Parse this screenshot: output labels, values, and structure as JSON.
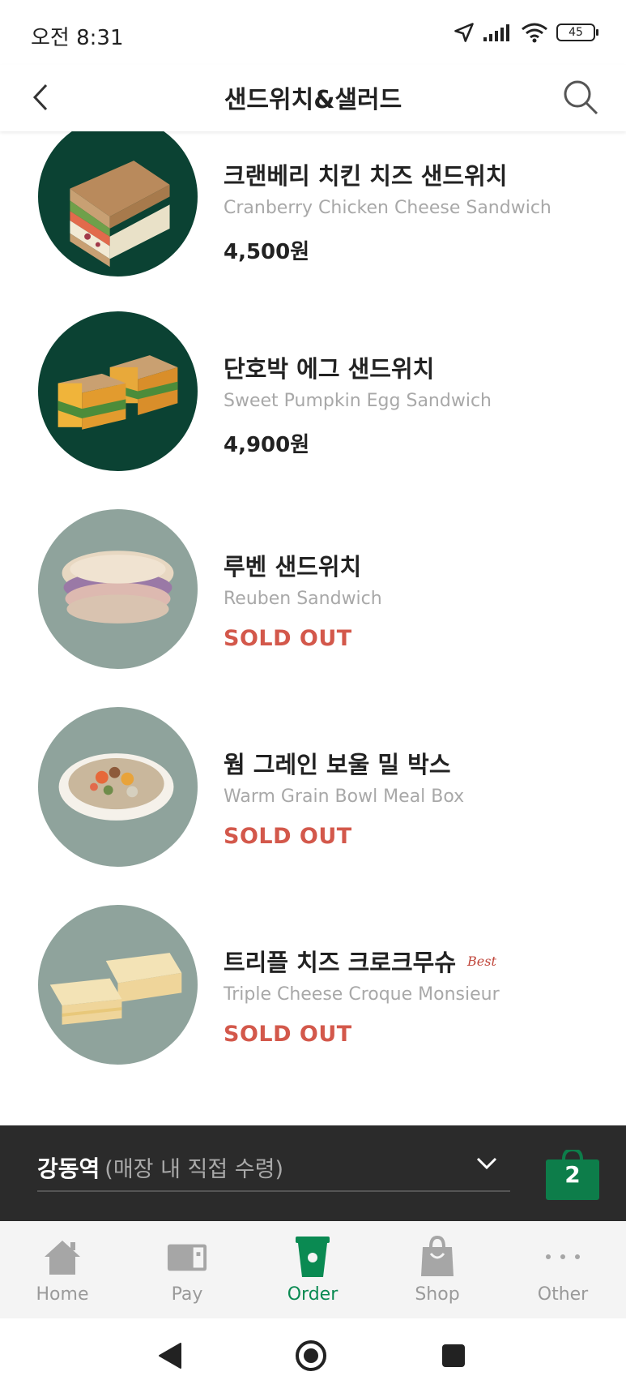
{
  "status_bar": {
    "time": "오전 8:31",
    "battery": "45"
  },
  "header": {
    "title": "샌드위치&샐러드"
  },
  "menu_items": [
    {
      "name_ko": "크랜베리 치킨 치즈 샌드위치",
      "name_en": "Cranberry Chicken Cheese Sandwich",
      "price": "4,500원"
    },
    {
      "name_ko": "단호박 에그 샌드위치",
      "name_en": "Sweet Pumpkin Egg Sandwich",
      "price": "4,900원"
    },
    {
      "name_ko": "루벤 샌드위치",
      "name_en": "Reuben Sandwich",
      "status": "SOLD OUT"
    },
    {
      "name_ko": "웜 그레인 보울 밀 박스",
      "name_en": "Warm Grain Bowl Meal Box",
      "status": "SOLD OUT"
    },
    {
      "name_ko": "트리플 치즈 크로크무슈",
      "badge": "Best",
      "name_en": "Triple Cheese Croque Monsieur",
      "status": "SOLD OUT"
    }
  ],
  "store_bar": {
    "store": "강동역",
    "pickup_note": "(매장 내 직접 수령)",
    "cart_count": "2"
  },
  "tab_bar": {
    "tabs": [
      {
        "label": "Home",
        "icon": "home-icon"
      },
      {
        "label": "Pay",
        "icon": "card-icon"
      },
      {
        "label": "Order",
        "icon": "cup-icon",
        "active": true
      },
      {
        "label": "Shop",
        "icon": "bag-icon"
      },
      {
        "label": "Other",
        "icon": "more-icon"
      }
    ]
  },
  "colors": {
    "accent_green": "#0a8a52",
    "sold_out_red": "#d3584b",
    "dark_green_circle": "#0b4233",
    "gray_circle": "#8fa39c",
    "store_bar_bg": "#2b2b2b",
    "cart_green": "#0d7d4a"
  },
  "nav_bar": {
    "icons": [
      "back-triangle-icon",
      "home-circle-icon",
      "recents-square-icon"
    ]
  }
}
